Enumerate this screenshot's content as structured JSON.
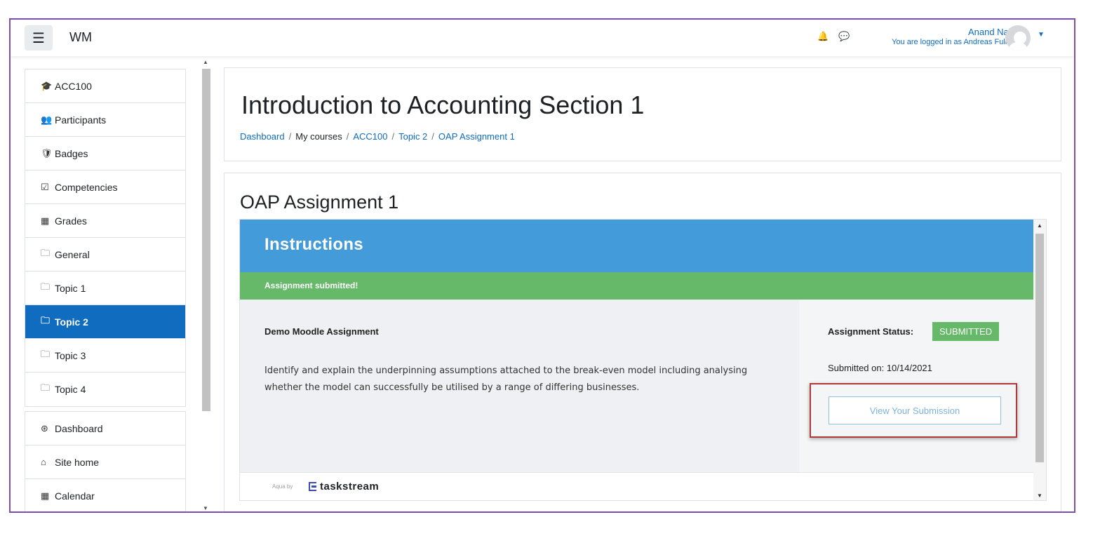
{
  "navbar": {
    "menu_icon": "☰",
    "site_name": "WM",
    "user_name": "Anand Nair",
    "login_as": "You are logged in as Andreas Fuller",
    "bell_icon": "🔔",
    "chat_icon": "💬"
  },
  "sidebar": {
    "course_items": [
      {
        "label": "ACC100",
        "icon": "🎓"
      },
      {
        "label": "Participants",
        "icon": "👥"
      },
      {
        "label": "Badges",
        "icon": "🛡"
      },
      {
        "label": "Competencies",
        "icon": "☑"
      },
      {
        "label": "Grades",
        "icon": "▦"
      },
      {
        "label": "General",
        "icon": "🗀"
      },
      {
        "label": "Topic 1",
        "icon": "🗀"
      },
      {
        "label": "Topic 2",
        "icon": "🗀"
      },
      {
        "label": "Topic 3",
        "icon": "🗀"
      },
      {
        "label": "Topic 4",
        "icon": "🗀"
      }
    ],
    "site_items": [
      {
        "label": "Dashboard",
        "icon": "⊛"
      },
      {
        "label": "Site home",
        "icon": "⌂"
      },
      {
        "label": "Calendar",
        "icon": "▦"
      }
    ],
    "active": "Topic 2"
  },
  "header": {
    "course_title": "Introduction to Accounting Section 1",
    "breadcrumb": [
      "Dashboard",
      "My courses",
      "ACC100",
      "Topic 2",
      "OAP Assignment 1"
    ]
  },
  "main": {
    "assignment_title": "OAP Assignment 1",
    "instructions_title": "Instructions",
    "banner": "Assignment submitted!",
    "demo_title": "Demo Moodle Assignment",
    "description": "Identify and explain the underpinning assumptions attached to the break-even model including analysing whether the model can successfully be utilised by a range of differing businesses.",
    "status_label": "Assignment Status:",
    "status_value": "SUBMITTED",
    "submitted_on": "Submitted on: 10/14/2021",
    "view_button": "View Your Submission",
    "footer_prefix": "Aqua by",
    "footer_brand": "taskstream"
  },
  "colors": {
    "primary": "#0f6cbf",
    "instructions_header": "#439bd9",
    "success": "#67b96a",
    "highlight": "#b03a3a"
  }
}
